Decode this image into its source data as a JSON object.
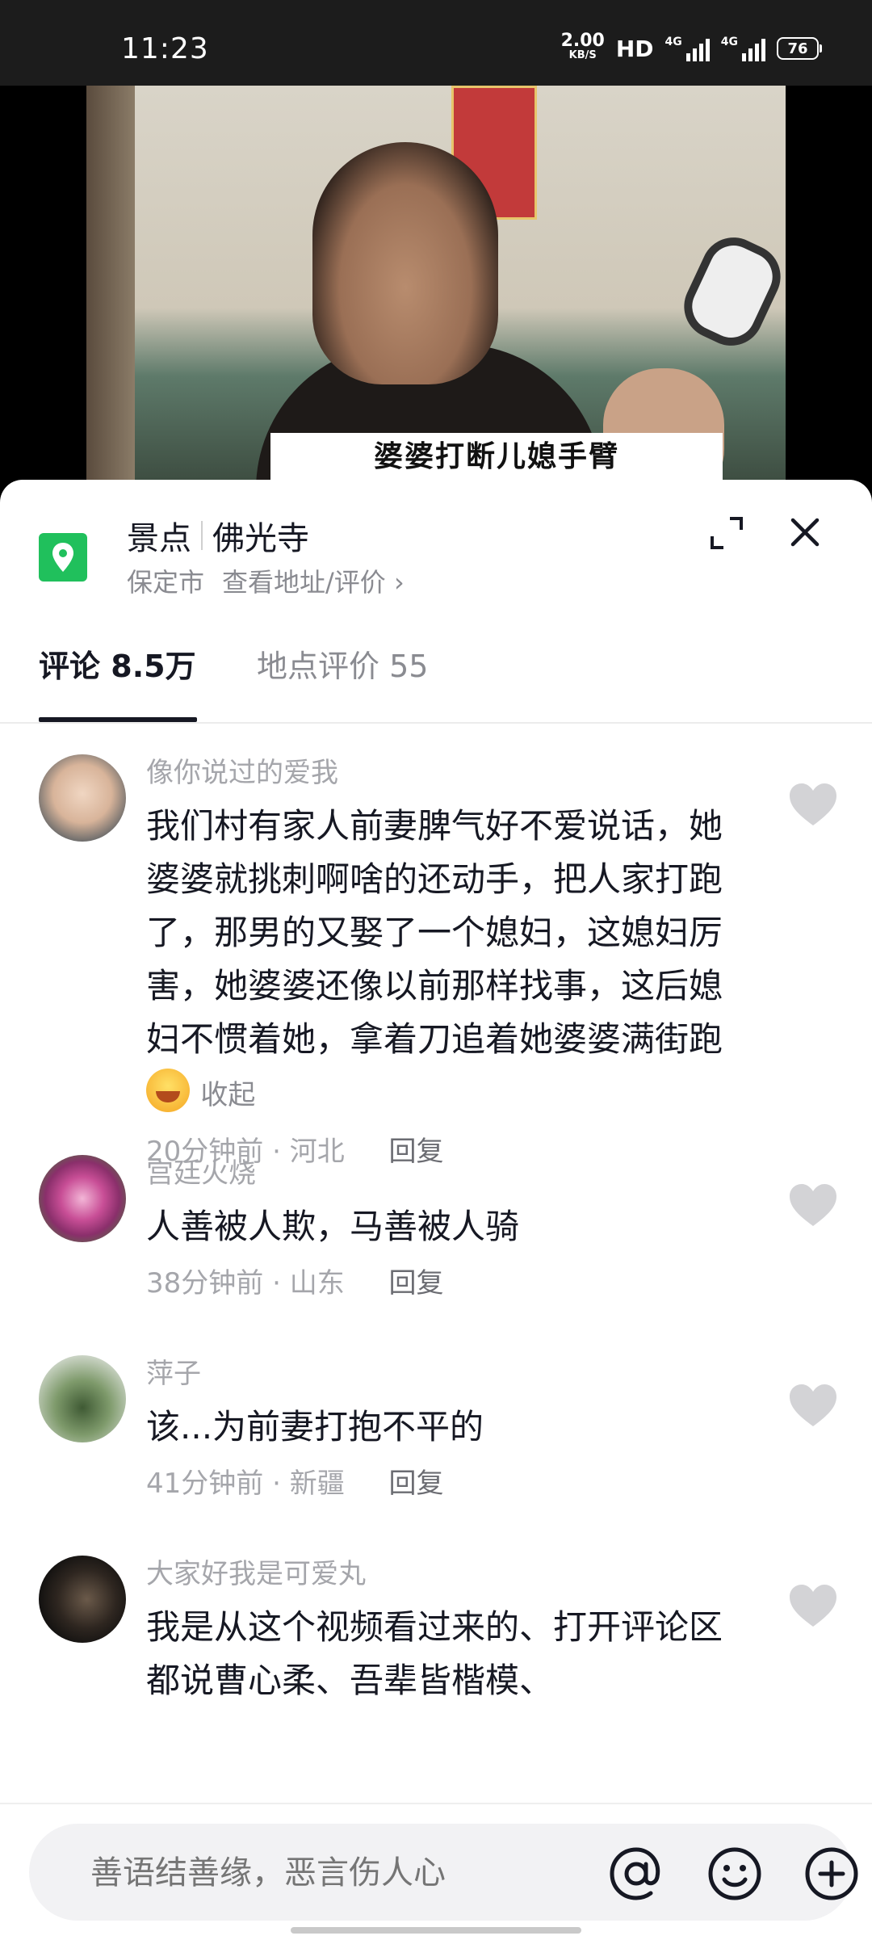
{
  "status_bar": {
    "time": "11:23",
    "net_speed": "2.00",
    "net_unit": "KB/S",
    "hd": "HD",
    "sig1_tag": "4G",
    "sig2_tag": "4G",
    "battery": "76"
  },
  "video": {
    "caption": "婆婆打断儿媳手臂"
  },
  "location": {
    "category": "景点",
    "name": "佛光寺",
    "city": "保定市",
    "link": "查看地址/评价",
    "link_chevron": "›"
  },
  "tabs": {
    "comments_label": "评论",
    "comments_count": "8.5万",
    "reviews_label": "地点评价",
    "reviews_count": "55"
  },
  "comments": [
    {
      "user": "像你说过的爱我",
      "text": "我们村有家人前妻脾气好不爱说话，她婆婆就挑刺啊啥的还动手，把人家打跑了，那男的又娶了一个媳妇，这媳妇厉害，她婆婆还像以前那样找事，这后媳妇不惯着她，拿着刀追着她婆婆满街跑",
      "collapse": "收起",
      "time": "20分钟前",
      "region": "河北",
      "reply": "回复"
    },
    {
      "user": "宫廷火烧",
      "text": "人善被人欺，马善被人骑",
      "time": "38分钟前",
      "region": "山东",
      "reply": "回复"
    },
    {
      "user": "萍子",
      "text": "该...为前妻打抱不平的",
      "time": "41分钟前",
      "region": "新疆",
      "reply": "回复"
    },
    {
      "user": "大家好我是可爱丸",
      "text": "我是从这个视频看过来的、打开评论区都说曹心柔、吾辈皆楷模、"
    }
  ],
  "input": {
    "placeholder": "善语结善缘，恶言伤人心"
  },
  "colors": {
    "pin_green": "#20c05c",
    "text_primary": "#161823",
    "text_secondary": "#8a8b91"
  }
}
